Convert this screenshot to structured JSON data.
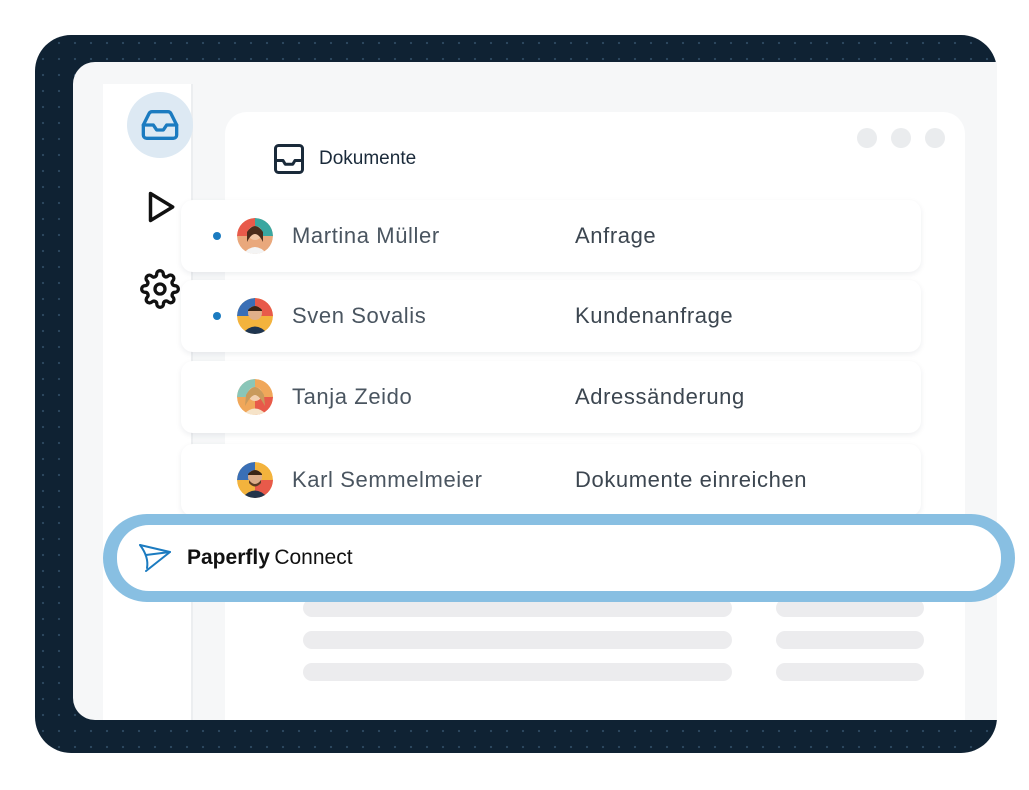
{
  "colors": {
    "frame_dark": "#0f2233",
    "accent_blue": "#1b7bc0",
    "connect_glow": "#88bfe2",
    "panel_bg": "#f6f7f8"
  },
  "sidebar": {
    "items": [
      {
        "icon": "inbox-icon",
        "active": true
      },
      {
        "icon": "play-icon",
        "active": false
      },
      {
        "icon": "gear-icon",
        "active": false
      }
    ]
  },
  "panel": {
    "title": "Dokumente",
    "title_icon": "inbox-icon"
  },
  "rows": [
    {
      "name": "Martina Müller",
      "subject": "Anfrage",
      "unread": true
    },
    {
      "name": "Sven Sovalis",
      "subject": "Kundenanfrage",
      "unread": true
    },
    {
      "name": "Tanja Zeido",
      "subject": "Adressänderung",
      "unread": false
    },
    {
      "name": "Karl Semmelmeier",
      "subject": "Dokumente einreichen",
      "unread": false
    }
  ],
  "connect": {
    "logo_icon": "paperfly-logo-icon",
    "brand": "Paperfly",
    "product": "Connect"
  }
}
